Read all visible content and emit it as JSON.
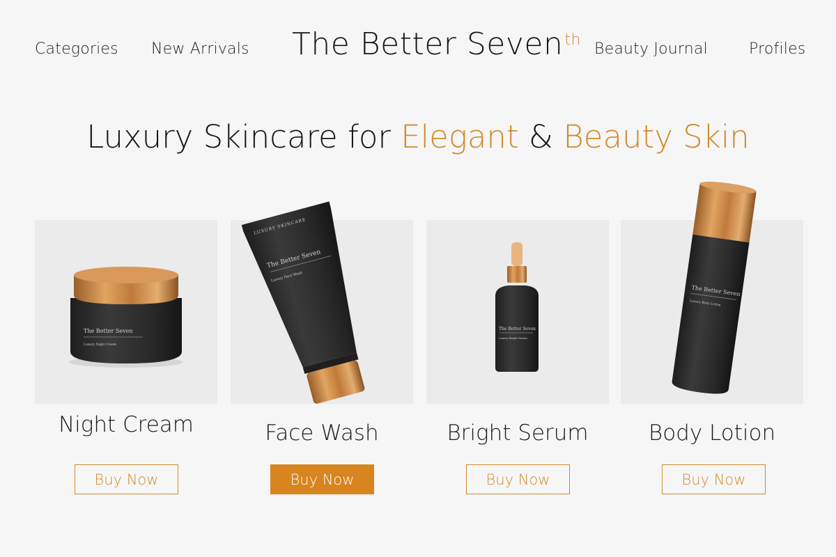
{
  "header": {
    "logo_text": "The Better Seven",
    "logo_sup": "th",
    "nav": {
      "categories": "Categories",
      "new_arrivals": "New Arrivals",
      "beauty_journal": "Beauty Journal",
      "profiles": "Profiles"
    }
  },
  "hero": {
    "part1": "Luxury Skincare for ",
    "accent1": "Elegant",
    "part2": " & ",
    "accent2": "Beauty Skin"
  },
  "products": [
    {
      "name": "Night Cream",
      "button": "Buy Now",
      "label_brand": "The Better Seven",
      "label_product": "Luxury Night Cream"
    },
    {
      "name": "Face Wash",
      "button": "Buy Now",
      "label_brand": "The Better Seven",
      "label_product": "Luxury Face Wash",
      "label_top": "LUXURY SKINCARE"
    },
    {
      "name": "Bright Serum",
      "button": "Buy Now",
      "label_brand": "The Better Seven",
      "label_product": "Luxury Bright Serum"
    },
    {
      "name": "Body Lotion",
      "button": "Buy Now",
      "label_brand": "The Better Seven",
      "label_product": "Luxury Body Lotion"
    }
  ],
  "colors": {
    "accent": "#d08a2c",
    "button_active": "#d8841f",
    "background": "#f6f6f6",
    "card": "#ebebeb",
    "product_dark": "#2c2c2c",
    "gold": "#c7853f"
  }
}
